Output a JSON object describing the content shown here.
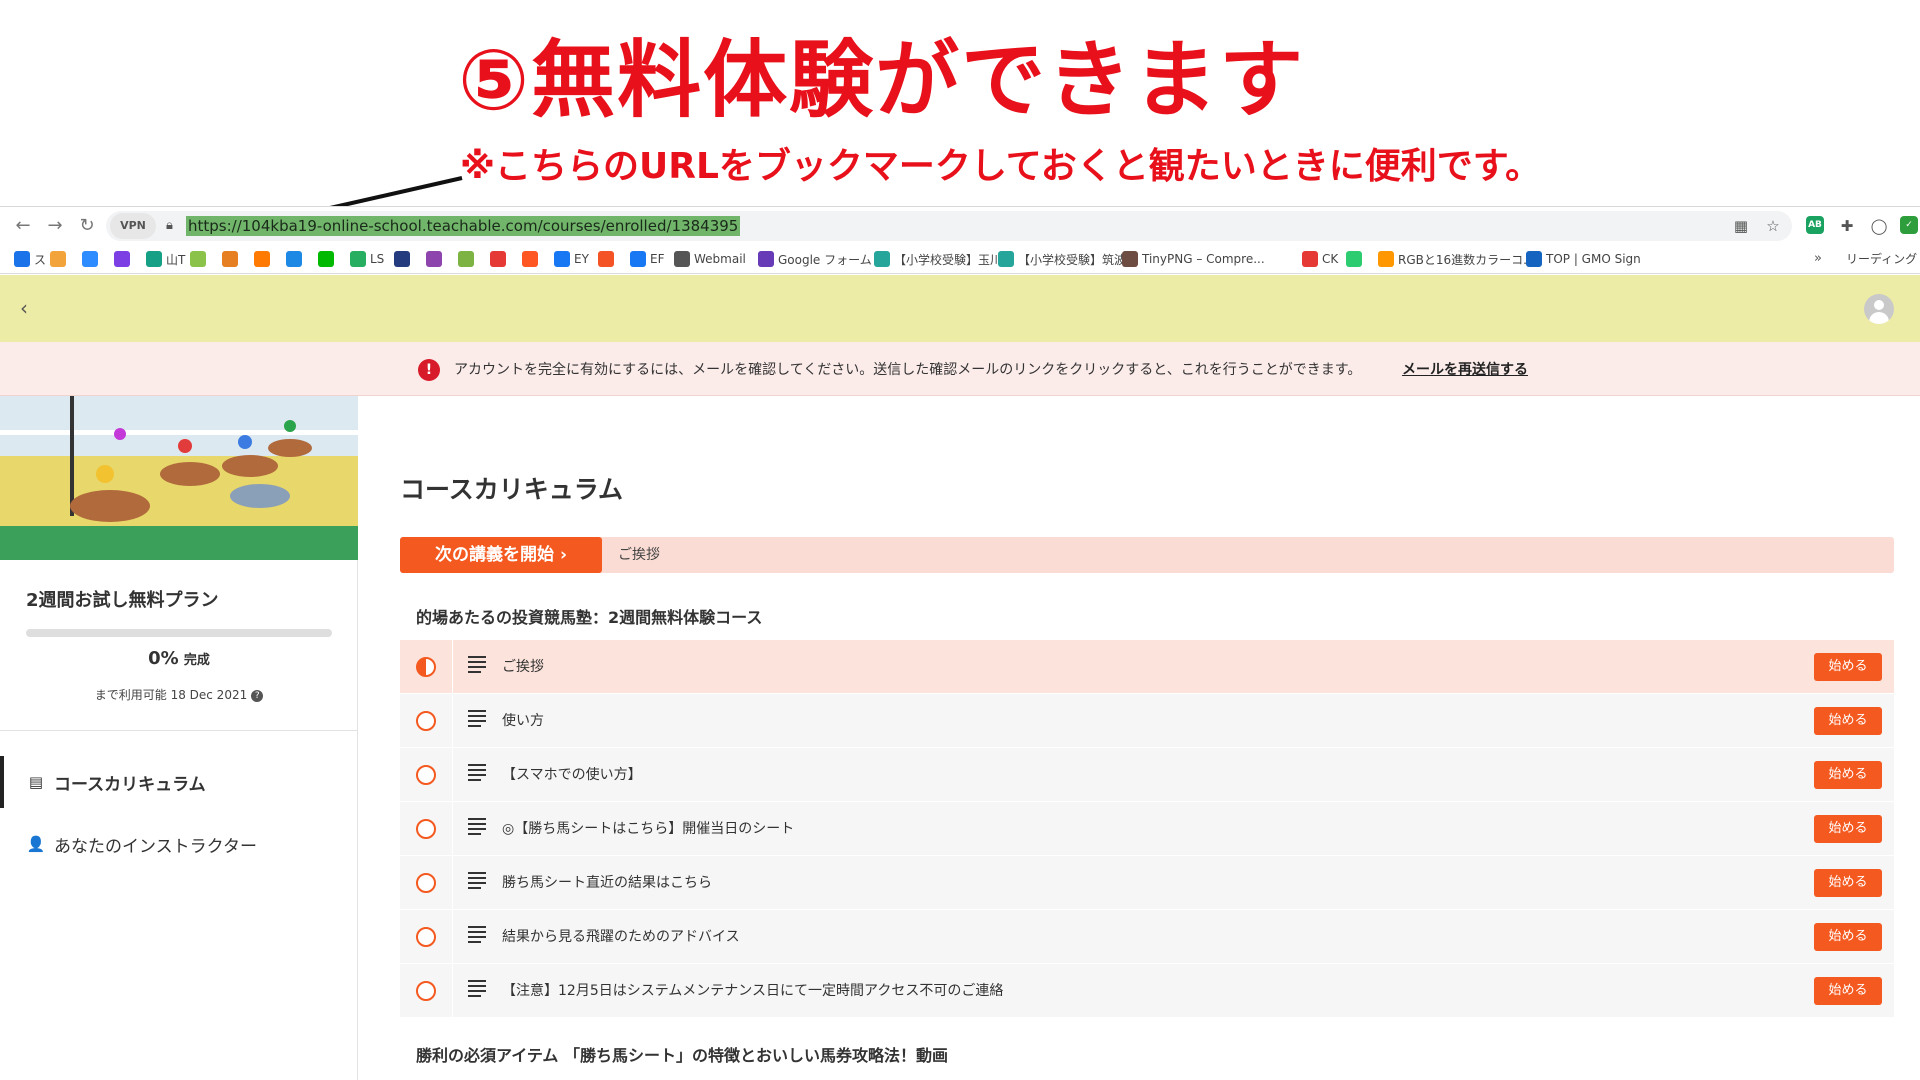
{
  "annotation": {
    "headline": "⑤無料体験ができます",
    "subline": "※こちらのURLをブックマークしておくと観たいときに便利です。"
  },
  "browser": {
    "vpn_label": "VPN",
    "url": "https://104kba19-online-school.teachable.com/courses/enrolled/1384395",
    "bookmarks": [
      {
        "label": "ス",
        "icon_color": "#1a73e8"
      },
      {
        "label": "",
        "icon_color": "#f2a33a"
      },
      {
        "label": "",
        "icon_color": "#2d8cff"
      },
      {
        "label": "",
        "icon_color": "#7b3fe4"
      },
      {
        "label": "山T",
        "icon_color": "#16a085"
      },
      {
        "label": "",
        "icon_color": "#8bc34a"
      },
      {
        "label": "",
        "icon_color": "#e67e22"
      },
      {
        "label": "",
        "icon_color": "#ff7a00"
      },
      {
        "label": "",
        "icon_color": "#1e88e5"
      },
      {
        "label": "",
        "icon_color": "#00b900"
      },
      {
        "label": "LS",
        "icon_color": "#27ae60"
      },
      {
        "label": "",
        "icon_color": "#253b80"
      },
      {
        "label": "",
        "icon_color": "#8e44ad"
      },
      {
        "label": "",
        "icon_color": "#7cb342"
      },
      {
        "label": "",
        "icon_color": "#e53935"
      },
      {
        "label": "",
        "icon_color": "#ff5722"
      },
      {
        "label": "EY",
        "icon_color": "#1877f2"
      },
      {
        "label": "",
        "icon_color": "#f35325"
      },
      {
        "label": "EF",
        "icon_color": "#1877f2"
      },
      {
        "label": "Webmail",
        "icon_color": "#555555"
      },
      {
        "label": "Google フォーム",
        "icon_color": "#673ab7"
      },
      {
        "label": "【小学校受験】玉川...",
        "icon_color": "#26a69a"
      },
      {
        "label": "【小学校受験】筑波...",
        "icon_color": "#26a69a"
      },
      {
        "label": "TinyPNG – Compre...",
        "icon_color": "#6d4c41"
      },
      {
        "label": "CK",
        "icon_color": "#e53935"
      },
      {
        "label": "",
        "icon_color": "#2ecc71"
      },
      {
        "label": "RGBと16進数カラーコ...",
        "icon_color": "#ff9800"
      },
      {
        "label": "TOP | GMO Sign",
        "icon_color": "#1565c0"
      }
    ],
    "more_label": "»",
    "reading_list": "リーディング"
  },
  "alert": {
    "icon": "!",
    "message": "アカウントを完全に有効にするには、メールを確認してください。送信した確認メールのリンクをクリックすると、これを行うことができます。",
    "link": "メールを再送信する"
  },
  "sidebar": {
    "course_title": "2週間お試し無料プラン",
    "progress_percent": 0,
    "progress_pct_label": "0%",
    "progress_suffix": "完成",
    "availability": "まで利用可能 18 Dec 2021",
    "nav": [
      {
        "label": "コースカリキュラム",
        "icon": "▤"
      },
      {
        "label": "あなたのインストラクター",
        "icon": "👤"
      }
    ]
  },
  "main": {
    "title": "コースカリキュラム",
    "next_button": "次の講義を開始  ›",
    "next_lecture": "ご挨拶",
    "section1_title": "的場あたるの投資競馬塾：2週間無料体験コース",
    "start_label": "始める",
    "lectures": [
      {
        "title": "ご挨拶"
      },
      {
        "title": "使い方"
      },
      {
        "title": "【スマホでの使い方】"
      },
      {
        "title": "◎【勝ち馬シートはこちら】開催当日のシート"
      },
      {
        "title": "勝ち馬シート直近の結果はこちら"
      },
      {
        "title": "結果から見る飛躍のためのアドバイス"
      },
      {
        "title": "【注意】12月5日はシステムメンテナンス日にて一定時間アクセス不可のご連絡"
      }
    ],
    "section2_title": "勝利の必須アイテム 「勝ち馬シート」の特徴とおいしい馬券攻略法！動画"
  },
  "colors": {
    "accent": "#f4591f",
    "annotation_red": "#e8101a",
    "header_bg": "#edeca6",
    "alert_bg": "#fbecea"
  }
}
